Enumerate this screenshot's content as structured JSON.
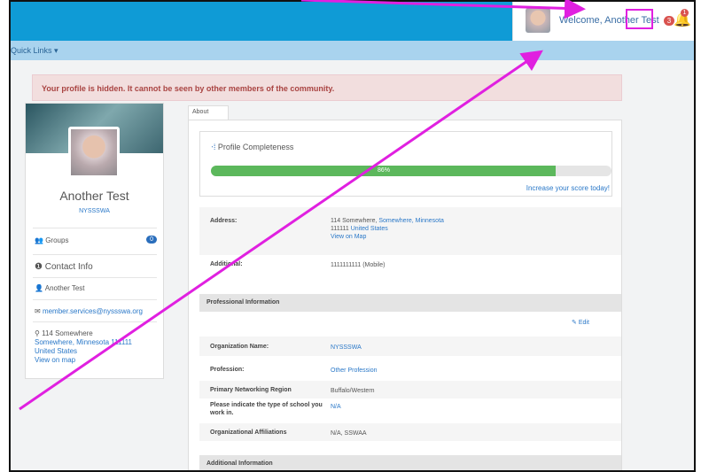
{
  "topbar": {
    "welcome_text": "Welcome, Another Test",
    "notif_count": "3",
    "bell_count": "1",
    "icons": [
      "avatar-image",
      "chevron-down-icon",
      "bell-icon"
    ]
  },
  "quick_links": {
    "label": "Quick Links ▾"
  },
  "alert": {
    "text": "Your profile is hidden. It cannot be seen by other members of the community."
  },
  "profile_card": {
    "name": "Another Test",
    "org": "NYSSSWA",
    "groups_label": "Groups",
    "groups_count": "0",
    "contact_heading": "Contact Info",
    "contact_name": "Another Test",
    "email": "member.services@nyssswa.org",
    "address_line1": "114 Somewhere",
    "address_line2": "Somewhere, Minnesota 111111",
    "address_line3": "United States",
    "view_map": "View on map"
  },
  "tabs": {
    "about": "About"
  },
  "completeness": {
    "title": "Profile Completeness",
    "percent": 86,
    "percent_label": "86%",
    "cta": "Increase your score today!"
  },
  "details": {
    "address_label": "Address:",
    "address_line1_a": "114 Somewhere,",
    "address_line1_b": "Somewhere,",
    "address_line1_c": "Minnesota",
    "address_line2_a": "111111",
    "address_line2_b": "United States",
    "view_map": "View on Map",
    "additional_label": "Additional:",
    "additional_value": "1111111111 (Mobile)"
  },
  "professional": {
    "heading": "Professional Information",
    "edit": "Edit",
    "rows": [
      {
        "label": "Organization Name:",
        "value": "NYSSSWA"
      },
      {
        "label": "Profession:",
        "value": "Other Profession"
      },
      {
        "label": "Primary Networking Region",
        "value": "Buffalo/Western"
      },
      {
        "label": "Please indicate the type of school you work in.",
        "value": "N/A"
      },
      {
        "label": "Organizational Affiliations",
        "value": "N/A, SSWAA"
      }
    ]
  },
  "additional": {
    "heading": "Additional Information"
  },
  "colors": {
    "topbar": "#0f9bd6",
    "quickbar": "#a9d3ee",
    "alert_bg": "#f2dede",
    "alert_text": "#a94442",
    "progress": "#5cb85c",
    "annotation": "#e020e0"
  }
}
